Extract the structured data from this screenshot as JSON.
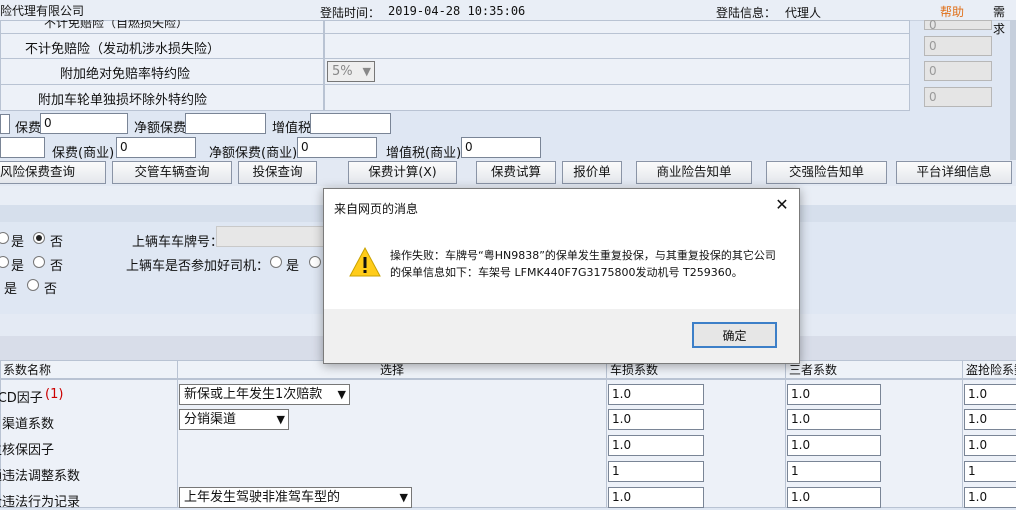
{
  "header": {
    "company": "险代理有限公司",
    "login_time_label": "登陆时间：",
    "login_time_value": "2019-04-28 10:35:06",
    "login_info_label": "登陆信息：",
    "login_info_value": "代理人",
    "help": "帮助",
    "more": "需求"
  },
  "coverage_rows": [
    {
      "label": "不计免赔险（自燃损失险）",
      "value": "0"
    },
    {
      "label": "不计免赔险（发动机涉水损失险）",
      "value": "0"
    },
    {
      "label": "附加绝对免赔率特约险",
      "value": "0",
      "select": "5%"
    },
    {
      "label": "附加车轮单独损坏除外特约险",
      "value": "0"
    }
  ],
  "premium_row1": {
    "premium_label": "保费",
    "premium_value": "0",
    "net_label": "净额保费",
    "vat_label": "增值税"
  },
  "premium_row2": {
    "premium_label": "保费(商业)",
    "premium_value": "0",
    "net_label": "净额保费(商业)",
    "net_value": "0",
    "vat_label": "增值税(商业)",
    "vat_value": "0"
  },
  "buttons": {
    "b1": "风险保费查询",
    "b2": "交管车辆查询",
    "b3": "投保查询",
    "b4": "保费计算(X)",
    "b5": "保费试算",
    "b6": "报价单",
    "b7": "商业险告知单",
    "b8": "交强险告知单",
    "b9": "平台详细信息"
  },
  "options": {
    "yes": "是",
    "no": "否",
    "last_plate_label": "上辆车车牌号：",
    "last_driver_label": "上辆车是否参加好司机：",
    "yes2": "是"
  },
  "table": {
    "headers": [
      "系数名称",
      "选择",
      "车损系数",
      "三者系数",
      "盗抢险系数"
    ],
    "rows": [
      {
        "name": "NCD因子",
        "mark": "(1)",
        "select": "新保或上年发生1次赔款",
        "c1": "1.0",
        "c2": "1.0",
        "c3": "1.0"
      },
      {
        "name": "渠道系数",
        "mark": "",
        "select": "分销渠道",
        "c1": "1.0",
        "c2": "1.0",
        "c3": "1.0"
      },
      {
        "name": "自主核保因子",
        "mark": "",
        "select": "",
        "c1": "1.0",
        "c2": "1.0",
        "c3": "1.0"
      },
      {
        "name": "交通违法调整系数",
        "mark": "",
        "select": "",
        "c1": "1",
        "c2": "1",
        "c3": "1"
      },
      {
        "name": "安全违法行为记录",
        "mark": "",
        "select": "上年发生驾驶非准驾车型的",
        "c1": "1.0",
        "c2": "1.0",
        "c3": "1.0"
      }
    ]
  },
  "dialog": {
    "title": "来自网页的消息",
    "message": "操作失败：车牌号“粤HN9838”的保单发生重复投保，与其重复投保的其它公司的保单信息如下：车架号 LFMK440F7G3175800发动机号 T259360。",
    "ok": "确定"
  }
}
